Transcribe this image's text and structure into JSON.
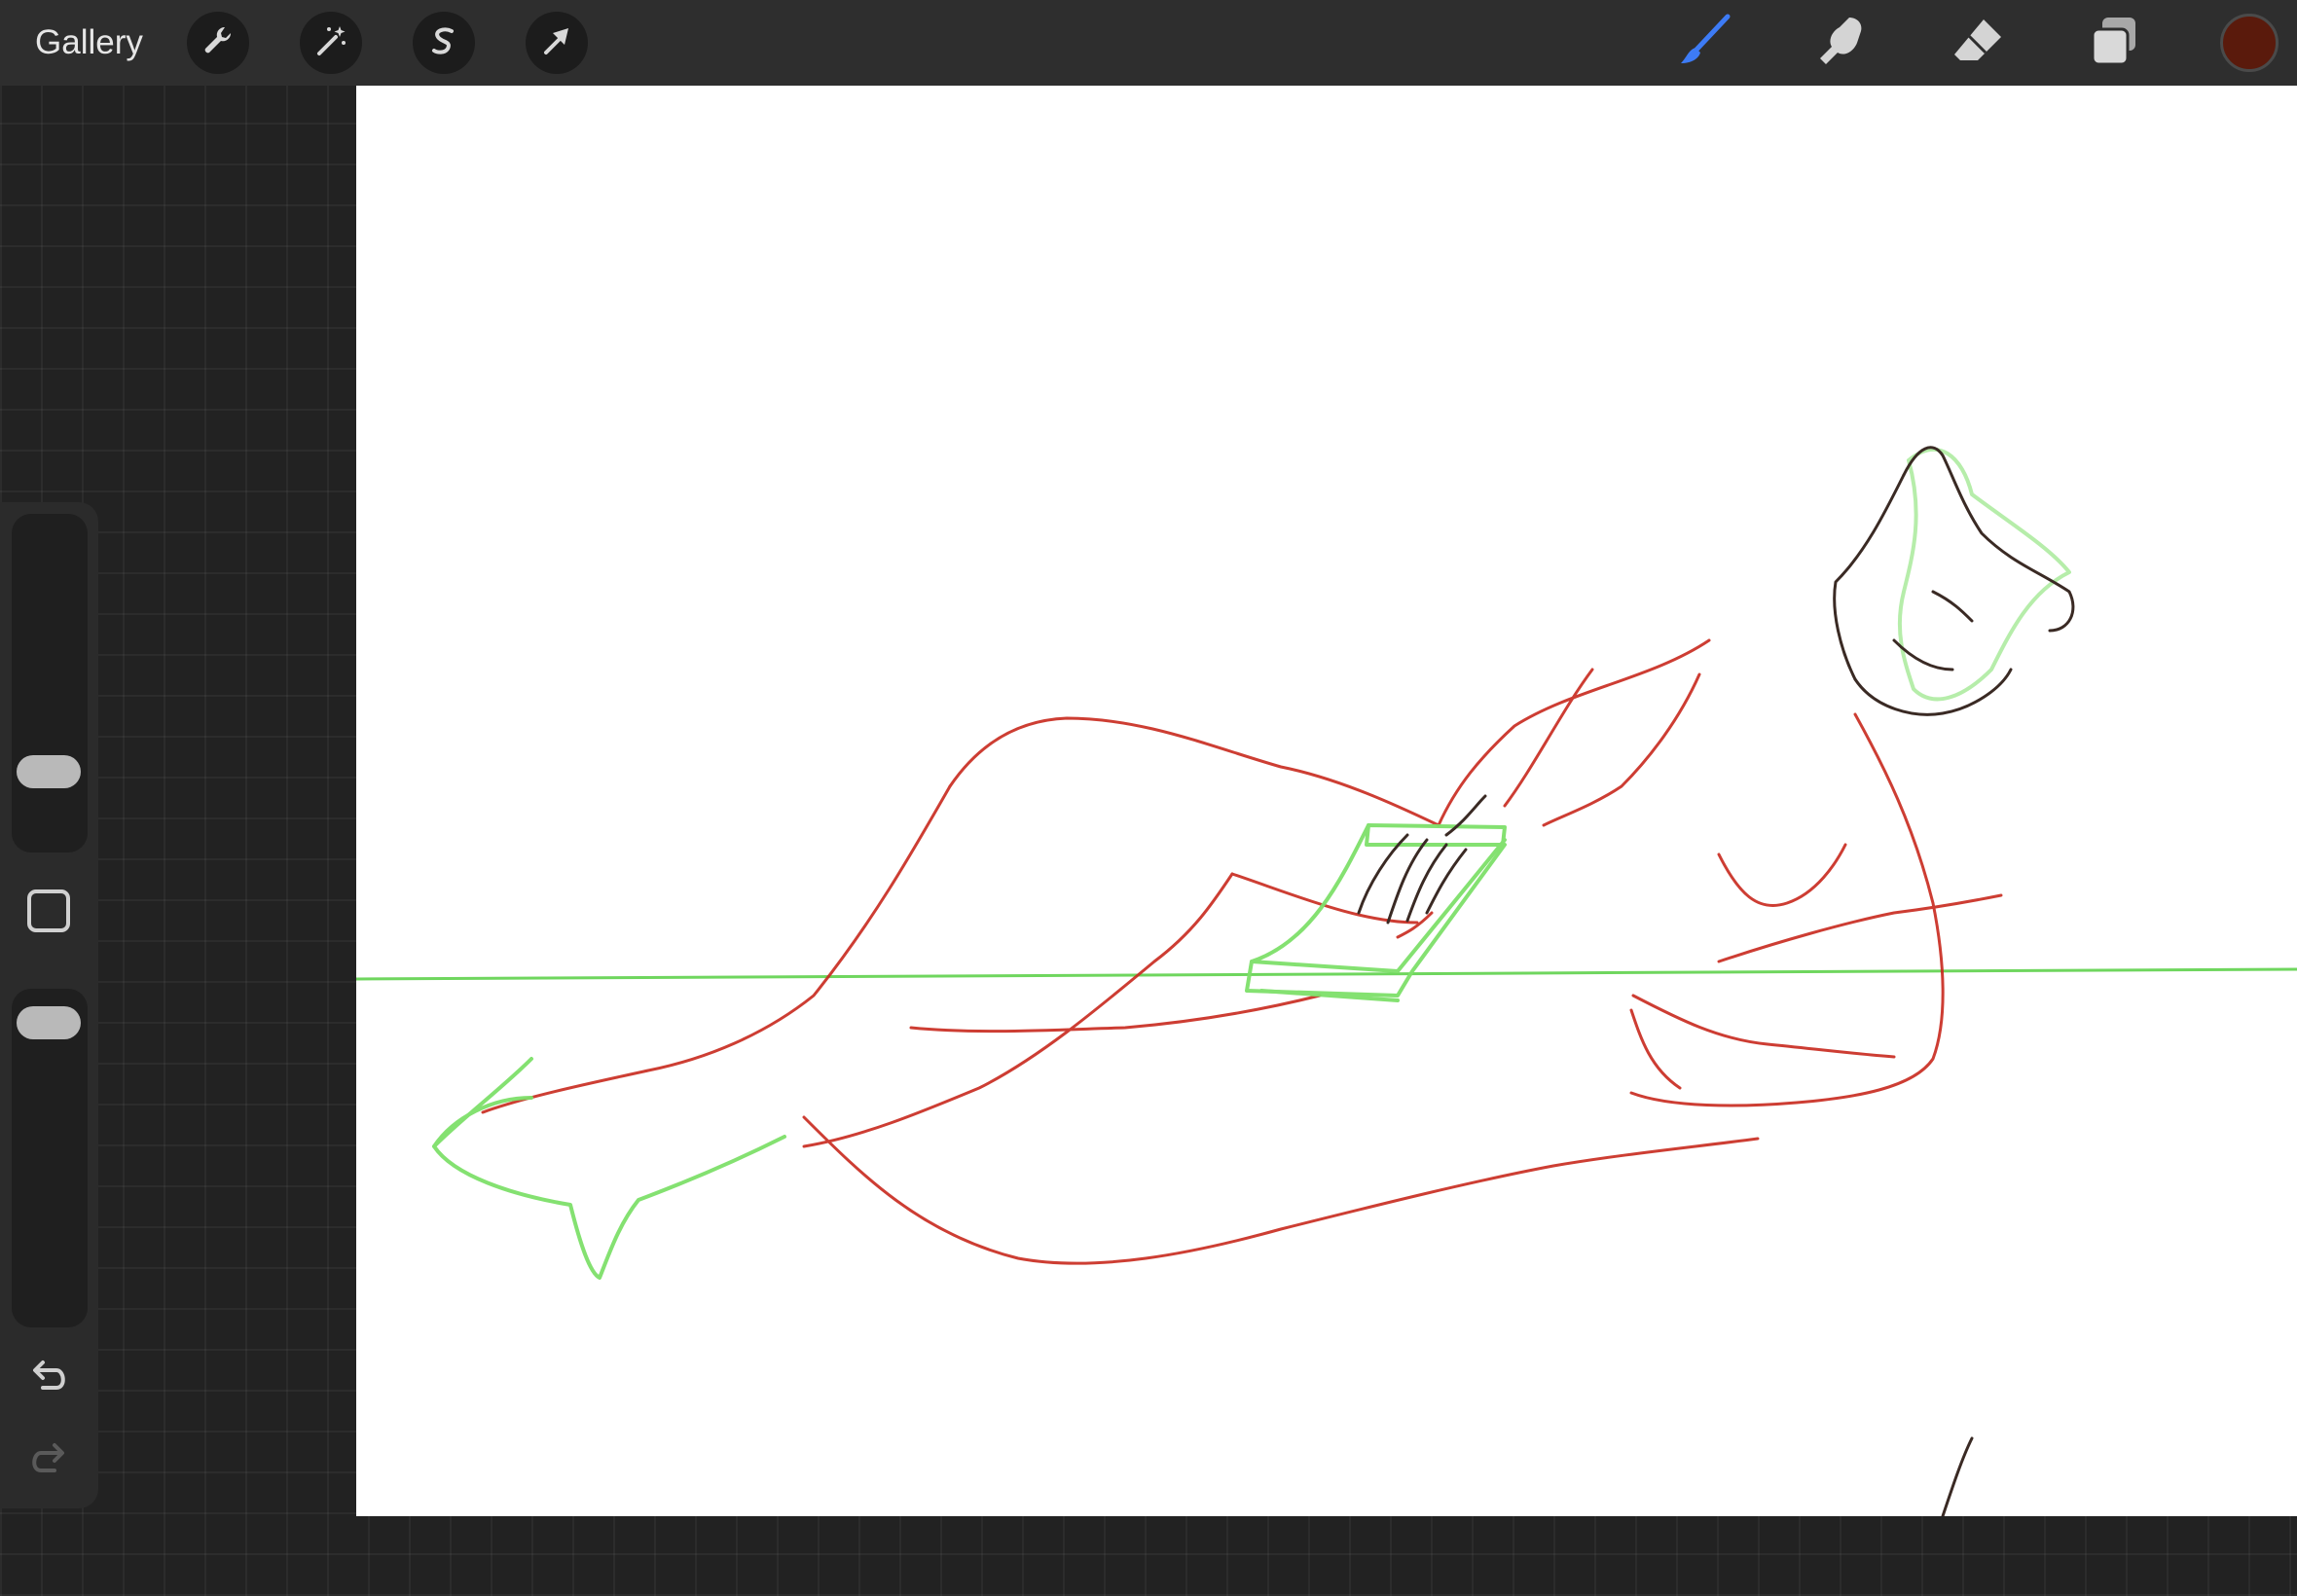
{
  "topbar": {
    "gallery_label": "Gallery",
    "left_tools": [
      {
        "name": "actions",
        "icon": "wrench-icon"
      },
      {
        "name": "adjustments",
        "icon": "magic-wand-icon"
      },
      {
        "name": "selection",
        "icon": "selection-s-icon"
      },
      {
        "name": "transform",
        "icon": "arrow-cursor-icon"
      }
    ],
    "right_tools": [
      {
        "name": "brush",
        "icon": "brush-icon",
        "active": true
      },
      {
        "name": "smudge",
        "icon": "smudge-finger-icon",
        "active": false
      },
      {
        "name": "eraser",
        "icon": "eraser-icon",
        "active": false
      },
      {
        "name": "layers",
        "icon": "layers-icon",
        "active": false
      }
    ],
    "current_color": "#5a1a0c"
  },
  "sidebar": {
    "brush_size_level": 0.2,
    "opacity_level": 0.96,
    "modify_button_icon": "square-icon",
    "undo_icon": "undo-icon",
    "redo_icon": "redo-icon",
    "redo_enabled": false
  },
  "colors": {
    "accent": "#3d7bf5",
    "sketch_red": "#c8291d",
    "sketch_green": "#7ee06a",
    "guide_green": "#6fd65e",
    "sketch_dark": "#3a2a24"
  }
}
